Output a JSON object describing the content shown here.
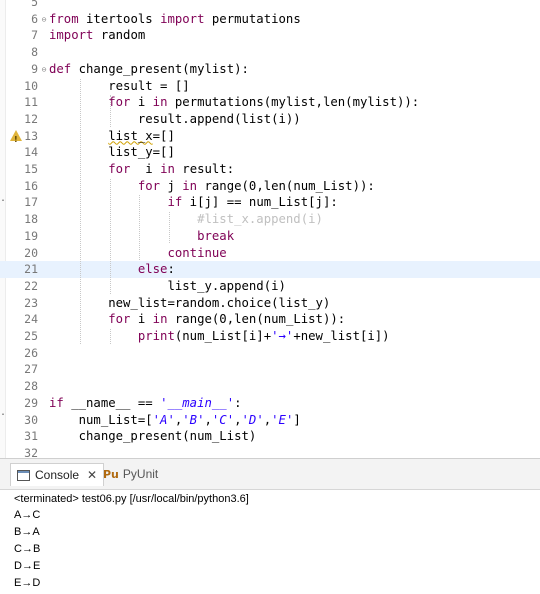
{
  "editor": {
    "lines": [
      {
        "n": "5",
        "text": ""
      },
      {
        "n": "6",
        "text": "from itertools import permutations",
        "fold": true
      },
      {
        "n": "7",
        "text": "import random"
      },
      {
        "n": "8",
        "text": ""
      },
      {
        "n": "9",
        "text": "def change_present(mylist):",
        "fold": true
      },
      {
        "n": "10",
        "text": "        result = []"
      },
      {
        "n": "11",
        "text": "        for i in permutations(mylist,len(mylist)):"
      },
      {
        "n": "12",
        "text": "            result.append(list(i))"
      },
      {
        "n": "13",
        "text": "        list_x=[]",
        "warning": true
      },
      {
        "n": "14",
        "text": "        list_y=[]"
      },
      {
        "n": "15",
        "text": "        for  i in result:"
      },
      {
        "n": "16",
        "text": "            for j in range(0,len(num_List)):"
      },
      {
        "n": "17",
        "text": "                if i[j] == num_List[j]:"
      },
      {
        "n": "18",
        "text": "                    #list_x.append(i)"
      },
      {
        "n": "19",
        "text": "                    break"
      },
      {
        "n": "20",
        "text": "                continue"
      },
      {
        "n": "21",
        "text": "            else:",
        "current": true
      },
      {
        "n": "22",
        "text": "                list_y.append(i)"
      },
      {
        "n": "23",
        "text": "        new_list=random.choice(list_y)"
      },
      {
        "n": "24",
        "text": "        for i in range(0,len(num_List)):"
      },
      {
        "n": "25",
        "text": "            print(num_List[i]+'→'+new_list[i])"
      },
      {
        "n": "26",
        "text": ""
      },
      {
        "n": "27",
        "text": ""
      },
      {
        "n": "28",
        "text": ""
      },
      {
        "n": "29",
        "text": "if __name__ == '__main__':"
      },
      {
        "n": "30",
        "text": "    num_List=['A','B','C','D','E']"
      },
      {
        "n": "31",
        "text": "    change_present(num_List)"
      },
      {
        "n": "32",
        "text": ""
      }
    ]
  },
  "console": {
    "tabs": [
      {
        "label": "Console",
        "icon": "console-icon",
        "active": true
      },
      {
        "label": "PyUnit",
        "icon": "pyunit-icon",
        "active": false
      }
    ],
    "status": "<terminated> test06.py [/usr/local/bin/python3.6]",
    "output": [
      "A→C",
      "B→A",
      "C→B",
      "D→E",
      "E→D"
    ]
  }
}
